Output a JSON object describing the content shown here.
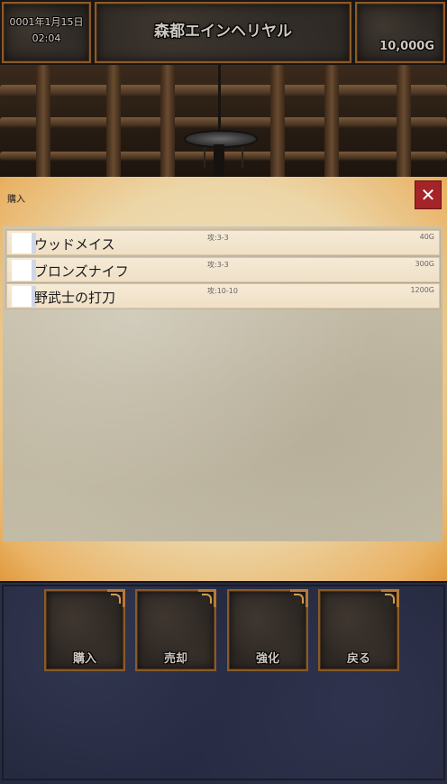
{
  "header": {
    "date": "0001年1月15日",
    "time": "02:04",
    "location": "森都エインヘリヤル",
    "gold": "10,000G"
  },
  "shop": {
    "title": "購入",
    "close_symbol": "✕",
    "items": [
      {
        "name": "ウッドメイス",
        "stat": "攻:3-3",
        "price": "40G"
      },
      {
        "name": "ブロンズナイフ",
        "stat": "攻:3-3",
        "price": "300G"
      },
      {
        "name": "野武士の打刀",
        "stat": "攻:10-10",
        "price": "1200G"
      }
    ]
  },
  "menu": {
    "buy": "購入",
    "sell": "売却",
    "upgrade": "強化",
    "back": "戻る"
  },
  "colors": {
    "close_button": "#a4242a",
    "frame_gold": "#8a5a28",
    "bottom_navy": "#262a40"
  },
  "icons": {
    "close": "close-icon",
    "item": "item-icon"
  }
}
